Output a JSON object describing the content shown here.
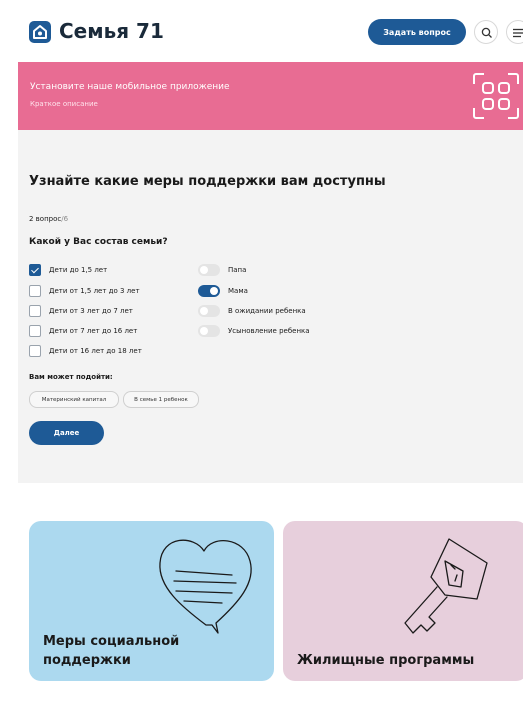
{
  "header": {
    "brand": "Семья 71",
    "ask_button": "Задать вопрос",
    "search_icon": "search-icon",
    "menu_icon": "menu-icon"
  },
  "banner": {
    "title": "Установите наше мобильное приложение",
    "subtitle": "Краткое описание",
    "icon": "qr-code-icon"
  },
  "quiz": {
    "heading": "Узнайте какие меры поддержки вам доступны",
    "counter_current": "2 вопрос",
    "counter_total": "/6",
    "question": "Какой у Вас состав семьи?",
    "checkboxes": [
      {
        "label": "Дети до 1,5 лет",
        "checked": true
      },
      {
        "label": "Дети от 1,5 лет до 3 лет",
        "checked": false
      },
      {
        "label": "Дети от 3 лет до 7 лет",
        "checked": false
      },
      {
        "label": "Дети от 7 лет до 16 лет",
        "checked": false
      },
      {
        "label": "Дети от 16 лет до 18 лет",
        "checked": false
      }
    ],
    "toggles": [
      {
        "label": "Папа",
        "on": false
      },
      {
        "label": "Мама",
        "on": true
      },
      {
        "label": "В ожидании ребенка",
        "on": false
      },
      {
        "label": "Усыновление ребенка",
        "on": false
      }
    ],
    "fit_label": "Вам может подойти:",
    "chips": [
      "Материнский капитал",
      "В семье 1 ребенок"
    ],
    "next_button": "Далее"
  },
  "cards": [
    {
      "title": "Меры социальной поддержки",
      "icon": "heart-message-icon"
    },
    {
      "title": "Жилищные программы",
      "icon": "house-key-icon"
    }
  ],
  "colors": {
    "primary": "#1e5a96",
    "banner": "#e86c93",
    "card_blue": "#acd9ef",
    "card_pink": "#e7cfdc"
  }
}
